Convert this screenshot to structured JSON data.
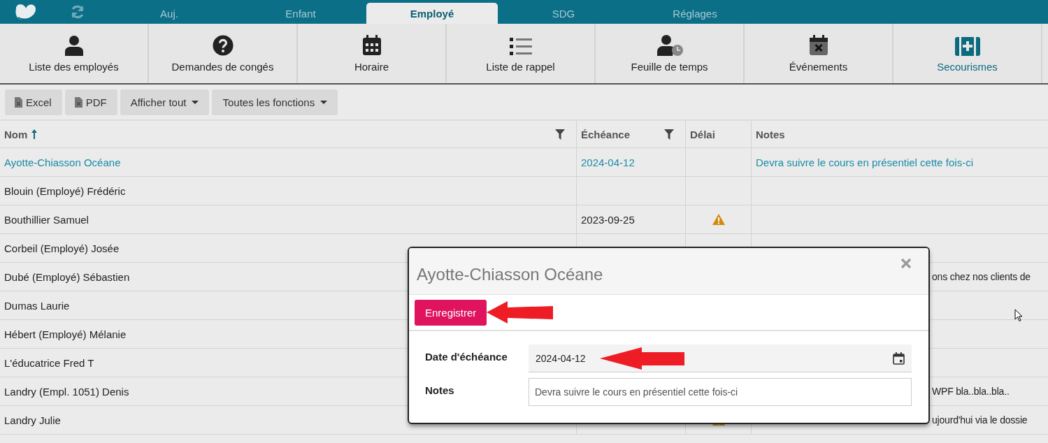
{
  "nav": {
    "tabs": [
      {
        "label": "Auj.",
        "selected": false
      },
      {
        "label": "Enfant",
        "selected": false
      },
      {
        "label": "Employé",
        "selected": true
      },
      {
        "label": "SDG",
        "selected": false
      },
      {
        "label": "Réglages",
        "selected": false
      }
    ]
  },
  "modules": [
    {
      "label": "Liste des employés",
      "selected": false
    },
    {
      "label": "Demandes de congés",
      "selected": false
    },
    {
      "label": "Horaire",
      "selected": false
    },
    {
      "label": "Liste de rappel",
      "selected": false
    },
    {
      "label": "Feuille de temps",
      "selected": false
    },
    {
      "label": "Événements",
      "selected": false
    },
    {
      "label": "Secourismes",
      "selected": true
    }
  ],
  "toolbar": [
    {
      "label": "Excel",
      "kind": "export"
    },
    {
      "label": "PDF",
      "kind": "export"
    },
    {
      "label": "Afficher tout",
      "kind": "dropdown"
    },
    {
      "label": "Toutes les fonctions",
      "kind": "dropdown"
    }
  ],
  "table": {
    "columns": [
      {
        "label": "Nom",
        "sorted": true,
        "filter": true
      },
      {
        "label": "Échéance",
        "sorted": false,
        "filter": true
      },
      {
        "label": "Délai",
        "sorted": false,
        "filter": false
      },
      {
        "label": "Notes",
        "sorted": false,
        "filter": false
      }
    ],
    "rows": [
      {
        "name": "Ayotte-Chiasson Océane",
        "due": "2024-04-12",
        "overdue": false,
        "notes": "Devra suivre le cours en présentiel cette fois-ci",
        "selected": true
      },
      {
        "name": "Blouin (Employé) Frédéric",
        "overdue": false,
        "selected": false
      },
      {
        "name": "Bouthillier Samuel",
        "due": "2023-09-25",
        "overdue": true,
        "selected": false
      },
      {
        "name": "Corbeil (Employé) Josée",
        "overdue": false,
        "selected": false
      },
      {
        "name": "Dubé (Employé) Sébastien",
        "notes": "ons chez nos clients de",
        "partial": true,
        "selected": false
      },
      {
        "name": "Dumas Laurie",
        "selected": false
      },
      {
        "name": "Hébert (Employé) Mélanie",
        "selected": false
      },
      {
        "name": "L'éducatrice Fred T",
        "selected": false
      },
      {
        "name": "Landry (Empl. 1051) Denis",
        "notes": "WPF bla..bla..bla..",
        "partial": true,
        "selected": false
      },
      {
        "name": "Landry Julie",
        "overdue": true,
        "notes": "ujourd'hui via le dossie",
        "partial": true,
        "selected": false
      }
    ]
  },
  "dialog": {
    "title": "Ayotte-Chiasson Océane",
    "save_button": "Enregistrer",
    "fields": [
      {
        "label": "Date d'échéance",
        "value": "2024-04-12",
        "kind": "date"
      },
      {
        "label": "Notes",
        "value": "Devra suivre le cours en présentiel cette fois-ci",
        "kind": "text"
      }
    ]
  }
}
